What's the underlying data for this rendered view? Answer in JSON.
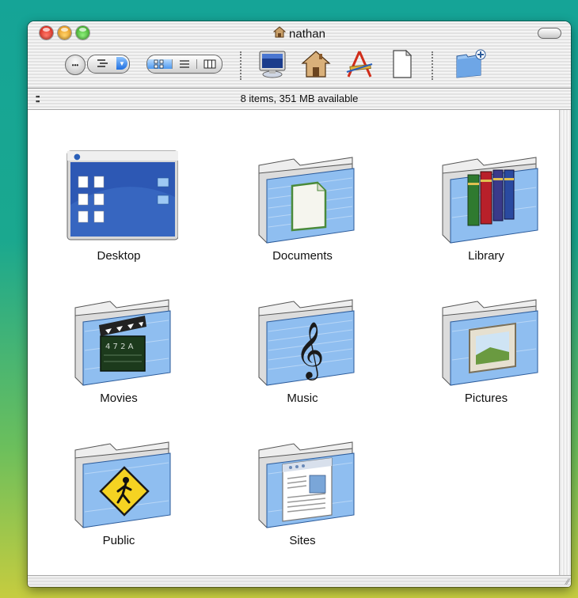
{
  "window": {
    "title": "nathan",
    "title_icon": "home-icon"
  },
  "toolbar": {
    "back_label": "•••",
    "action_icon": "action-menu-icon",
    "view_modes": [
      "icon-view-icon",
      "list-view-icon",
      "column-view-icon"
    ],
    "active_view": "icon-view-icon",
    "shortcuts": [
      "computer-icon",
      "home-icon",
      "applications-icon",
      "documents-icon"
    ],
    "new_folder_icon": "new-folder-icon"
  },
  "status": {
    "text": "8 items, 351 MB available"
  },
  "items": [
    {
      "label": "Desktop",
      "icon": "desktop-folder-icon"
    },
    {
      "label": "Documents",
      "icon": "documents-folder-icon"
    },
    {
      "label": "Library",
      "icon": "library-folder-icon"
    },
    {
      "label": "Movies",
      "icon": "movies-folder-icon"
    },
    {
      "label": "Music",
      "icon": "music-folder-icon"
    },
    {
      "label": "Pictures",
      "icon": "pictures-folder-icon"
    },
    {
      "label": "Public",
      "icon": "public-folder-icon"
    },
    {
      "label": "Sites",
      "icon": "sites-folder-icon"
    }
  ],
  "colors": {
    "folder_blue": "#8fbef0",
    "active_segment": "#4c98ef"
  }
}
